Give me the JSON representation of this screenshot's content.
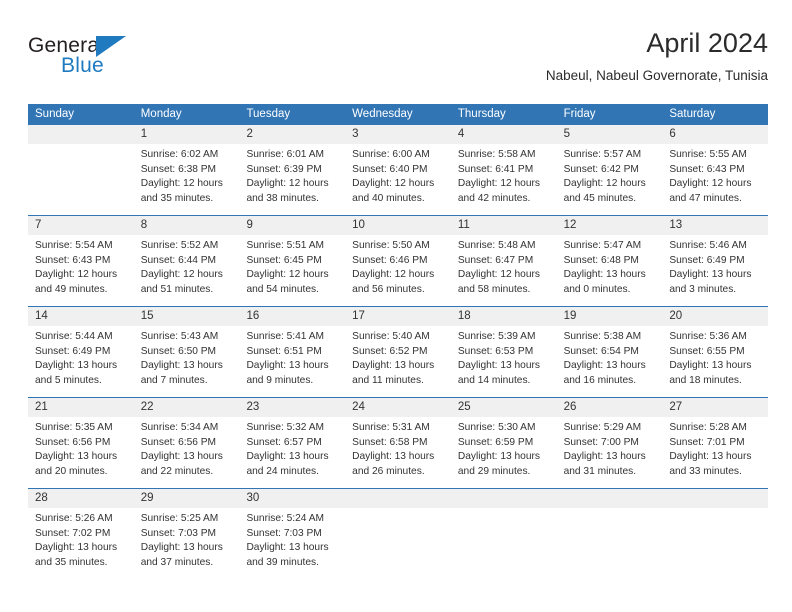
{
  "brand": {
    "name_part1": "General",
    "name_part2": "Blue",
    "triangle_icon": "triangle-icon",
    "colors": {
      "dark": "#231f20",
      "blue": "#1f7ac0"
    }
  },
  "header": {
    "title": "April 2024",
    "location": "Nabeul, Nabeul Governorate, Tunisia"
  },
  "theme": {
    "header_blue": "#3175b5",
    "date_band_gray": "#f0f0f0",
    "text": "#333333"
  },
  "calendar": {
    "weekdays": [
      "Sunday",
      "Monday",
      "Tuesday",
      "Wednesday",
      "Thursday",
      "Friday",
      "Saturday"
    ],
    "weeks": [
      [
        {
          "day": "",
          "lines": []
        },
        {
          "day": "1",
          "lines": [
            "Sunrise: 6:02 AM",
            "Sunset: 6:38 PM",
            "Daylight: 12 hours",
            "and 35 minutes."
          ]
        },
        {
          "day": "2",
          "lines": [
            "Sunrise: 6:01 AM",
            "Sunset: 6:39 PM",
            "Daylight: 12 hours",
            "and 38 minutes."
          ]
        },
        {
          "day": "3",
          "lines": [
            "Sunrise: 6:00 AM",
            "Sunset: 6:40 PM",
            "Daylight: 12 hours",
            "and 40 minutes."
          ]
        },
        {
          "day": "4",
          "lines": [
            "Sunrise: 5:58 AM",
            "Sunset: 6:41 PM",
            "Daylight: 12 hours",
            "and 42 minutes."
          ]
        },
        {
          "day": "5",
          "lines": [
            "Sunrise: 5:57 AM",
            "Sunset: 6:42 PM",
            "Daylight: 12 hours",
            "and 45 minutes."
          ]
        },
        {
          "day": "6",
          "lines": [
            "Sunrise: 5:55 AM",
            "Sunset: 6:43 PM",
            "Daylight: 12 hours",
            "and 47 minutes."
          ]
        }
      ],
      [
        {
          "day": "7",
          "lines": [
            "Sunrise: 5:54 AM",
            "Sunset: 6:43 PM",
            "Daylight: 12 hours",
            "and 49 minutes."
          ]
        },
        {
          "day": "8",
          "lines": [
            "Sunrise: 5:52 AM",
            "Sunset: 6:44 PM",
            "Daylight: 12 hours",
            "and 51 minutes."
          ]
        },
        {
          "day": "9",
          "lines": [
            "Sunrise: 5:51 AM",
            "Sunset: 6:45 PM",
            "Daylight: 12 hours",
            "and 54 minutes."
          ]
        },
        {
          "day": "10",
          "lines": [
            "Sunrise: 5:50 AM",
            "Sunset: 6:46 PM",
            "Daylight: 12 hours",
            "and 56 minutes."
          ]
        },
        {
          "day": "11",
          "lines": [
            "Sunrise: 5:48 AM",
            "Sunset: 6:47 PM",
            "Daylight: 12 hours",
            "and 58 minutes."
          ]
        },
        {
          "day": "12",
          "lines": [
            "Sunrise: 5:47 AM",
            "Sunset: 6:48 PM",
            "Daylight: 13 hours",
            "and 0 minutes."
          ]
        },
        {
          "day": "13",
          "lines": [
            "Sunrise: 5:46 AM",
            "Sunset: 6:49 PM",
            "Daylight: 13 hours",
            "and 3 minutes."
          ]
        }
      ],
      [
        {
          "day": "14",
          "lines": [
            "Sunrise: 5:44 AM",
            "Sunset: 6:49 PM",
            "Daylight: 13 hours",
            "and 5 minutes."
          ]
        },
        {
          "day": "15",
          "lines": [
            "Sunrise: 5:43 AM",
            "Sunset: 6:50 PM",
            "Daylight: 13 hours",
            "and 7 minutes."
          ]
        },
        {
          "day": "16",
          "lines": [
            "Sunrise: 5:41 AM",
            "Sunset: 6:51 PM",
            "Daylight: 13 hours",
            "and 9 minutes."
          ]
        },
        {
          "day": "17",
          "lines": [
            "Sunrise: 5:40 AM",
            "Sunset: 6:52 PM",
            "Daylight: 13 hours",
            "and 11 minutes."
          ]
        },
        {
          "day": "18",
          "lines": [
            "Sunrise: 5:39 AM",
            "Sunset: 6:53 PM",
            "Daylight: 13 hours",
            "and 14 minutes."
          ]
        },
        {
          "day": "19",
          "lines": [
            "Sunrise: 5:38 AM",
            "Sunset: 6:54 PM",
            "Daylight: 13 hours",
            "and 16 minutes."
          ]
        },
        {
          "day": "20",
          "lines": [
            "Sunrise: 5:36 AM",
            "Sunset: 6:55 PM",
            "Daylight: 13 hours",
            "and 18 minutes."
          ]
        }
      ],
      [
        {
          "day": "21",
          "lines": [
            "Sunrise: 5:35 AM",
            "Sunset: 6:56 PM",
            "Daylight: 13 hours",
            "and 20 minutes."
          ]
        },
        {
          "day": "22",
          "lines": [
            "Sunrise: 5:34 AM",
            "Sunset: 6:56 PM",
            "Daylight: 13 hours",
            "and 22 minutes."
          ]
        },
        {
          "day": "23",
          "lines": [
            "Sunrise: 5:32 AM",
            "Sunset: 6:57 PM",
            "Daylight: 13 hours",
            "and 24 minutes."
          ]
        },
        {
          "day": "24",
          "lines": [
            "Sunrise: 5:31 AM",
            "Sunset: 6:58 PM",
            "Daylight: 13 hours",
            "and 26 minutes."
          ]
        },
        {
          "day": "25",
          "lines": [
            "Sunrise: 5:30 AM",
            "Sunset: 6:59 PM",
            "Daylight: 13 hours",
            "and 29 minutes."
          ]
        },
        {
          "day": "26",
          "lines": [
            "Sunrise: 5:29 AM",
            "Sunset: 7:00 PM",
            "Daylight: 13 hours",
            "and 31 minutes."
          ]
        },
        {
          "day": "27",
          "lines": [
            "Sunrise: 5:28 AM",
            "Sunset: 7:01 PM",
            "Daylight: 13 hours",
            "and 33 minutes."
          ]
        }
      ],
      [
        {
          "day": "28",
          "lines": [
            "Sunrise: 5:26 AM",
            "Sunset: 7:02 PM",
            "Daylight: 13 hours",
            "and 35 minutes."
          ]
        },
        {
          "day": "29",
          "lines": [
            "Sunrise: 5:25 AM",
            "Sunset: 7:03 PM",
            "Daylight: 13 hours",
            "and 37 minutes."
          ]
        },
        {
          "day": "30",
          "lines": [
            "Sunrise: 5:24 AM",
            "Sunset: 7:03 PM",
            "Daylight: 13 hours",
            "and 39 minutes."
          ]
        },
        {
          "day": "",
          "lines": []
        },
        {
          "day": "",
          "lines": []
        },
        {
          "day": "",
          "lines": []
        },
        {
          "day": "",
          "lines": []
        }
      ]
    ]
  }
}
